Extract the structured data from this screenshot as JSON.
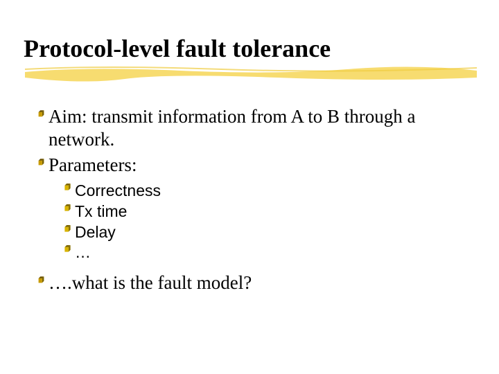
{
  "title": "Protocol-level fault tolerance",
  "colors": {
    "bullet1": "#c79a00",
    "bullet1_shadow": "#6b5200",
    "bullet2": "#d8b300",
    "bullet2_shadow": "#7a6300",
    "highlight": "#f6d860"
  },
  "bullets": {
    "l1": [
      "Aim: transmit information from A to B through a network.",
      "Parameters:",
      "….what is the fault model?"
    ],
    "l2": [
      "Correctness",
      "Tx time",
      "Delay",
      "…"
    ]
  }
}
